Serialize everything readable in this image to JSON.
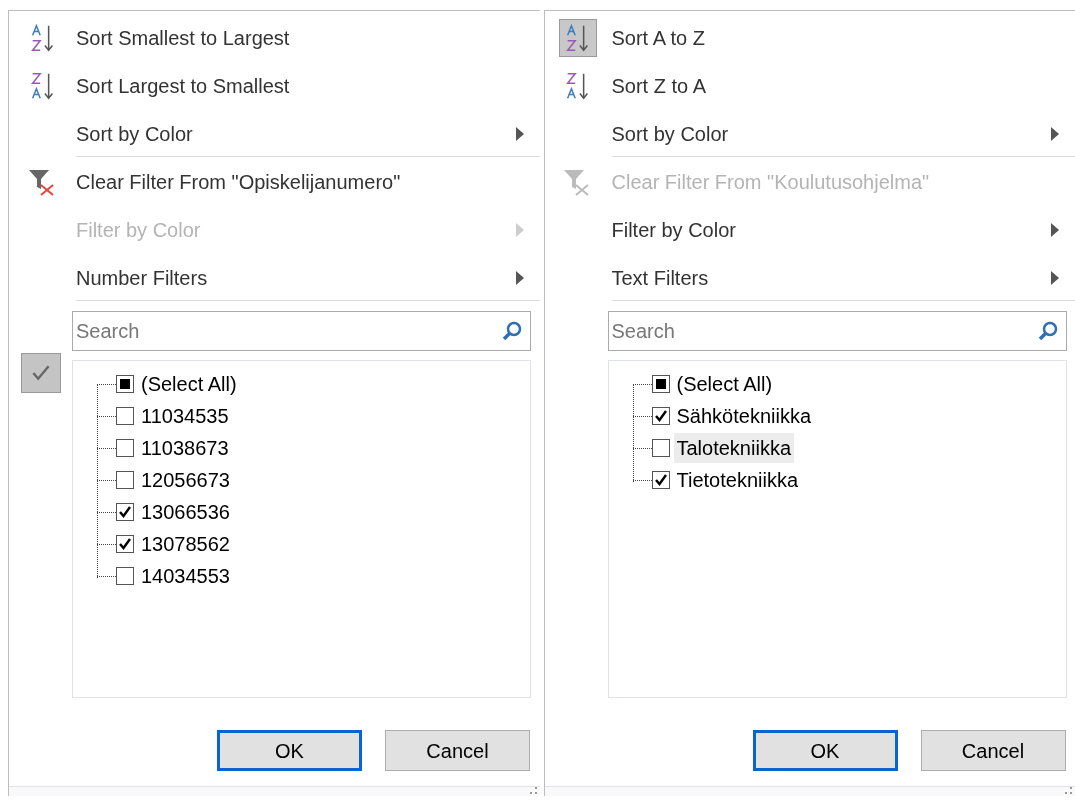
{
  "panels": [
    {
      "menu": [
        {
          "kind": "sort_ascending",
          "label": "Sort Smallest to Largest",
          "disabled": false,
          "submenu": false,
          "highlighted": false
        },
        {
          "kind": "sort_descending",
          "label": "Sort Largest to Smallest",
          "disabled": false,
          "submenu": false,
          "highlighted": false
        },
        {
          "kind": "plain",
          "label": "Sort by Color",
          "disabled": false,
          "submenu": true,
          "highlighted": false
        },
        {
          "kind": "clear_filter",
          "label": "Clear Filter From \"Opiskelijanumero\"",
          "disabled": false,
          "submenu": false,
          "highlighted": false
        },
        {
          "kind": "plain",
          "label": "Filter by Color",
          "disabled": true,
          "submenu": true,
          "highlighted": false
        },
        {
          "kind": "plain",
          "label": "Number Filters",
          "disabled": false,
          "submenu": true,
          "highlighted": false
        }
      ],
      "side_check": true,
      "search": {
        "placeholder": "Search"
      },
      "items": [
        {
          "label": "(Select All)",
          "checked": false,
          "partial": true,
          "highlighted": false
        },
        {
          "label": "11034535",
          "checked": false,
          "highlighted": false
        },
        {
          "label": "11038673",
          "checked": false,
          "highlighted": false
        },
        {
          "label": "12056673",
          "checked": false,
          "highlighted": false
        },
        {
          "label": "13066536",
          "checked": true,
          "highlighted": false
        },
        {
          "label": "13078562",
          "checked": true,
          "highlighted": false
        },
        {
          "label": "14034553",
          "checked": false,
          "highlighted": false
        }
      ],
      "buttons": [
        {
          "label": "OK",
          "default": true
        },
        {
          "label": "Cancel",
          "default": false
        }
      ]
    },
    {
      "menu": [
        {
          "kind": "sort_ascending",
          "label": "Sort A to Z",
          "disabled": false,
          "submenu": false,
          "highlighted": true
        },
        {
          "kind": "sort_descending",
          "label": "Sort Z to A",
          "disabled": false,
          "submenu": false,
          "highlighted": false
        },
        {
          "kind": "plain",
          "label": "Sort by Color",
          "disabled": false,
          "submenu": true,
          "highlighted": false
        },
        {
          "kind": "clear_filter",
          "label": "Clear Filter From \"Koulutusohjelma\"",
          "disabled": true,
          "submenu": false,
          "highlighted": false
        },
        {
          "kind": "plain",
          "label": "Filter by Color",
          "disabled": false,
          "submenu": true,
          "highlighted": false
        },
        {
          "kind": "plain",
          "label": "Text Filters",
          "disabled": false,
          "submenu": true,
          "highlighted": false
        }
      ],
      "side_check": false,
      "search": {
        "placeholder": "Search"
      },
      "items": [
        {
          "label": "(Select All)",
          "checked": false,
          "partial": true,
          "highlighted": false
        },
        {
          "label": "Sähkötekniikka",
          "checked": true,
          "highlighted": false
        },
        {
          "label": "Talotekniikka",
          "checked": false,
          "highlighted": true
        },
        {
          "label": "Tietotekniikka",
          "checked": true,
          "highlighted": false
        }
      ],
      "buttons": [
        {
          "label": "OK",
          "default": true
        },
        {
          "label": "Cancel",
          "default": false
        }
      ]
    }
  ]
}
